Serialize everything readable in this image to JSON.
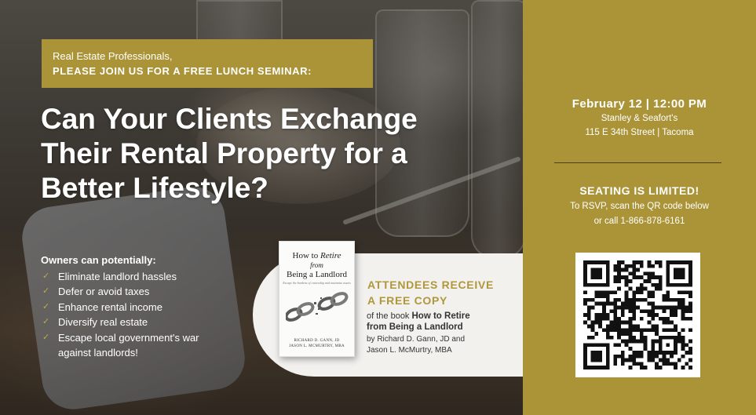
{
  "header": {
    "intro": "Real Estate Professionals,",
    "invite": "PLEASE JOIN US FOR A FREE LUNCH SEMINAR:"
  },
  "headline": {
    "line1": "Can Your Clients Exchange",
    "line2": "Their Rental Property for a",
    "line3": "Better Lifestyle?"
  },
  "owners": {
    "title": "Owners can potentially:",
    "items": [
      "Eliminate landlord hassles",
      "Defer or avoid taxes",
      "Enhance rental income",
      "Diversify real estate",
      "Escape local government's war",
      "against landlords!"
    ]
  },
  "book": {
    "title_part1": "How to",
    "title_part2": "Retire",
    "title_part3": "from",
    "title_part4": "Being a Landlord",
    "subtitle": "Escape the burdens of ownership and maximize assets",
    "author1": "RICHARD D. GANN, JD",
    "author2": "JASON L. MCMURTRY, MBA"
  },
  "callout": {
    "receive_line1": "ATTENDEES RECEIVE",
    "receive_line2": "A FREE COPY",
    "of_the_book": "of the book",
    "book_title_line1": "How to Retire",
    "book_title_line2": "from Being a Landlord",
    "byline1": "by Richard D. Gann, JD and",
    "byline2": "Jason L. McMurtry, MBA"
  },
  "event": {
    "date": "February 12 | 12:00 PM",
    "venue": "Stanley & Seafort's",
    "address": "115 E 34th Street | Tacoma",
    "seating": "SEATING IS LIMITED!",
    "rsvp1": "To RSVP, scan the QR code below",
    "rsvp2": "or call 1-866-878-6161"
  },
  "colors": {
    "gold": "#ab9437",
    "gold_text": "#b0973c",
    "callout_bg": "#f2f1ee"
  },
  "icons": {
    "check": "check-icon",
    "qr": "qr-code-icon"
  }
}
